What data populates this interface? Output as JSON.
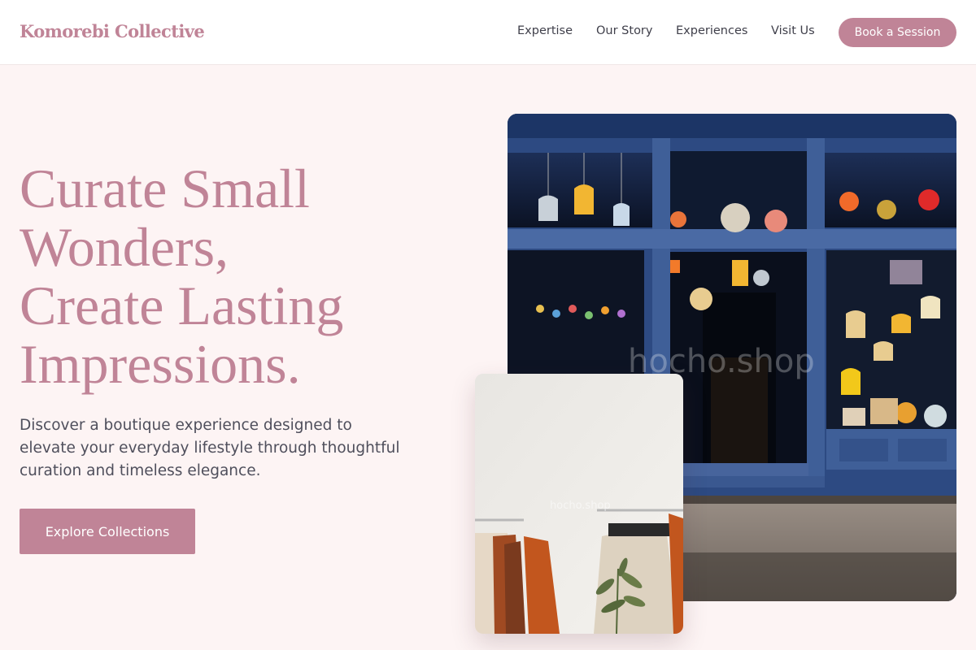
{
  "brand": {
    "name": "Komorebi Collective",
    "accent": "#c08497"
  },
  "nav": {
    "links": [
      "Expertise",
      "Our Story",
      "Experiences",
      "Visit Us"
    ],
    "cta": "Book a Session"
  },
  "hero": {
    "title_lines": [
      "Curate Small",
      "Wonders,",
      "Create Lasting",
      "Impressions."
    ],
    "description_lines": [
      "Discover a boutique experience designed to",
      "elevate your everyday lifestyle through thoughtful",
      "curation and timeless elegance."
    ],
    "button": "Explore Collections"
  },
  "images": {
    "storefront": {
      "alt": "Storefront with hanging lamps",
      "watermark": "hocho.shop"
    },
    "boutique": {
      "alt": "Clothing rack in a bright boutique",
      "watermark": "hocho.shop"
    }
  }
}
